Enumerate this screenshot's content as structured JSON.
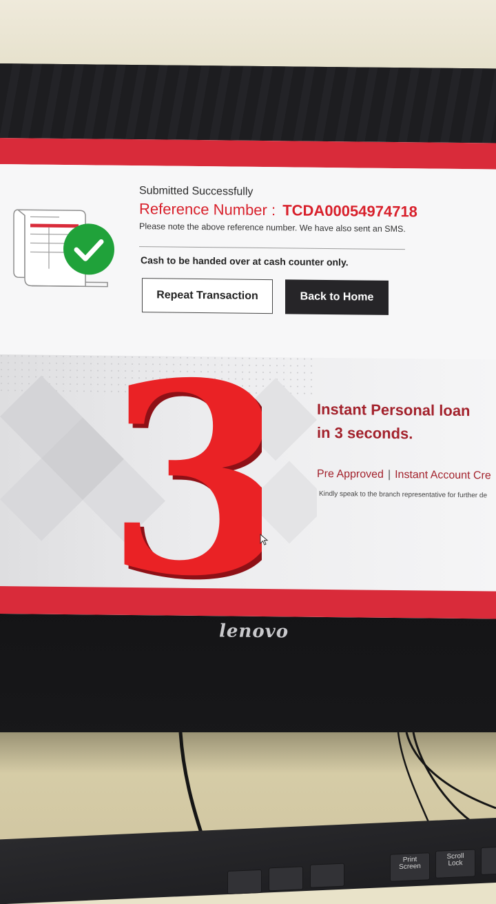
{
  "dialog": {
    "status": "Submitted Successfully",
    "reference_label": "Reference Number :",
    "reference_number": "TCDA00054974718",
    "note": "Please note the above reference number. We have also sent an SMS.",
    "cash_notice": "Cash to be handed over at cash counter only.",
    "repeat_button": "Repeat Transaction",
    "home_button": "Back to Home"
  },
  "promo": {
    "digit": "3",
    "title_line1": "Instant Personal loan",
    "title_line2": "in 3 seconds.",
    "feature1": "Pre Approved",
    "separator": "|",
    "feature2": "Instant Account Cre",
    "footnote": "Kindly speak to the branch representative for further de"
  },
  "monitor": {
    "brand": "lenovo"
  },
  "keyboard": {
    "key1_line1": "Print",
    "key1_line2": "Screen",
    "key2_line1": "Scroll",
    "key2_line2": "Lock"
  },
  "colors": {
    "brand_red": "#d92b3a",
    "promo_red": "#a3222c",
    "success_green": "#20a23a",
    "dark_button": "#262528"
  }
}
